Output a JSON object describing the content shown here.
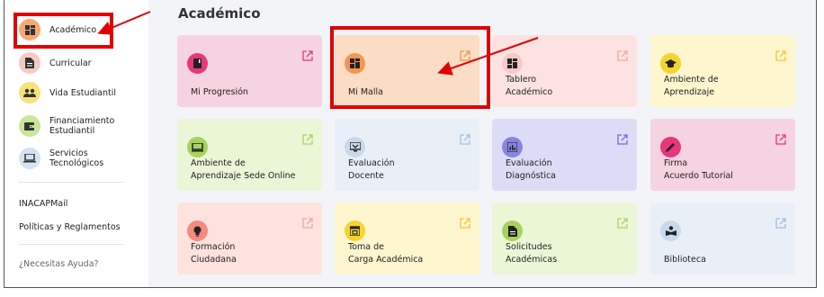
{
  "sidebar": {
    "items": [
      {
        "label": "Académico",
        "icon": "grid-icon",
        "bg": "#f7a872",
        "fg": "#333333"
      },
      {
        "label": "Curricular",
        "icon": "document-icon",
        "bg": "#f8c9c4",
        "fg": "#333333"
      },
      {
        "label": "Vida Estudiantil",
        "icon": "people-icon",
        "bg": "#f6e27a",
        "fg": "#333333"
      },
      {
        "label": "Financiamiento\nEstudiantil",
        "icon": "wallet-icon",
        "bg": "#c9e59a",
        "fg": "#333333"
      },
      {
        "label": "Servicios\nTecnológicos",
        "icon": "laptop-icon",
        "bg": "#d3e3f2",
        "fg": "#333333"
      }
    ],
    "links": [
      "INACAPMail",
      "Políticas y Reglamentos"
    ],
    "help": "¿Necesitas Ayuda?"
  },
  "main": {
    "title": "Académico",
    "cards": [
      {
        "label": "Mi Progresión",
        "icon": "book-icon",
        "bg": "#f6d3e0",
        "icon_bg": "#e8367d",
        "ext": "#e8367d"
      },
      {
        "label": "Mi Malla",
        "icon": "grid-icon",
        "bg": "#fbdcc4",
        "icon_bg": "#f3964e",
        "ext": "#f3964e"
      },
      {
        "label": "Tablero\nAcadémico",
        "icon": "dashboard-icon",
        "bg": "#fce3e1",
        "icon_bg": "#f8c9c4",
        "ext": "#f0a7a0"
      },
      {
        "label": "Ambiente de\nAprendizaje",
        "icon": "graduation-cap-icon",
        "bg": "#fdf6cf",
        "icon_bg": "#f5d42e",
        "ext": "#f5c82e"
      },
      {
        "label": "Ambiente de\nAprendizaje Sede Online",
        "icon": "monitor-icon",
        "bg": "#ebf6d7",
        "icon_bg": "#a6d35d",
        "ext": "#a6d35d"
      },
      {
        "label": "Evaluación\nDocente",
        "icon": "screen-check-icon",
        "bg": "#e9eff7",
        "icon_bg": "#c9d9ec",
        "ext": "#9fc0df"
      },
      {
        "label": "Evaluación\nDiagnóstica",
        "icon": "bar-chart-icon",
        "bg": "#dcdcf6",
        "icon_bg": "#8686de",
        "ext": "#6d6ddb"
      },
      {
        "label": "Firma\nAcuerdo Tutorial",
        "icon": "pen-icon",
        "bg": "#f6d3e0",
        "icon_bg": "#e8367d",
        "ext": "#e8367d"
      },
      {
        "label": "Formación\nCiudadana",
        "icon": "lightbulb-icon",
        "bg": "#fde2dd",
        "icon_bg": "#f58a7d",
        "ext": "#f3a79d"
      },
      {
        "label": "Toma de\nCarga Académica",
        "icon": "calendar-icon",
        "bg": "#fdf6cf",
        "icon_bg": "#f5d42e",
        "ext": "#f5c82e"
      },
      {
        "label": "Solicitudes\nAcadémicas",
        "icon": "document-icon",
        "bg": "#ebf6d7",
        "icon_bg": "#a6d35d",
        "ext": "#a6d35d"
      },
      {
        "label": "Biblioteca",
        "icon": "reader-icon",
        "bg": "#e9eff7",
        "icon_bg": "#c9d9ec",
        "ext": "#9fc0df"
      }
    ]
  },
  "colors": {
    "annotation": "#e00000"
  }
}
